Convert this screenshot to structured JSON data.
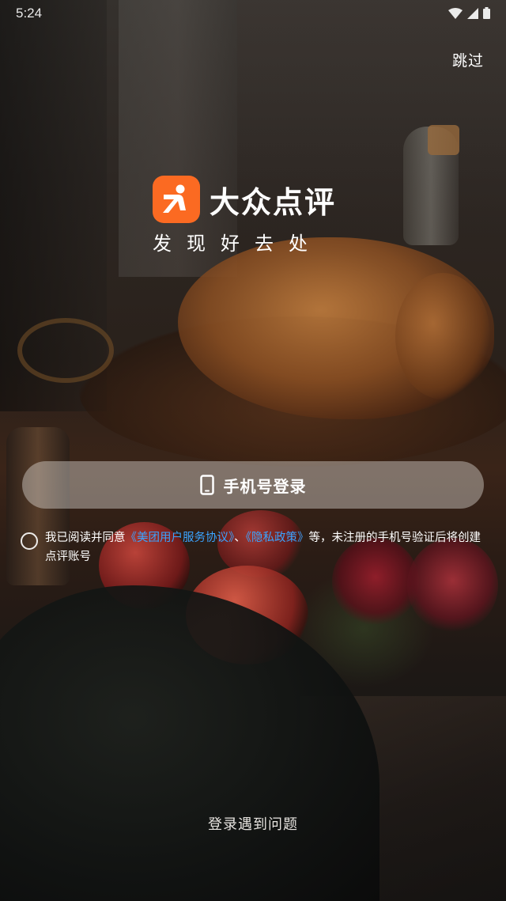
{
  "status_bar": {
    "time": "5:24",
    "icons": [
      "wifi-icon",
      "signal-icon",
      "battery-icon"
    ]
  },
  "header": {
    "skip_label": "跳过"
  },
  "brand": {
    "name": "大众点评",
    "slogan": "发现好去处",
    "logo_icon": "dianping-person-icon",
    "logo_color": "#fb6a22"
  },
  "login": {
    "phone_button_label": "手机号登录",
    "phone_icon": "mobile-phone-icon"
  },
  "agreement": {
    "checked": false,
    "prefix": "我已阅读并同意",
    "service_link": "《美团用户服务协议》",
    "separator": "、",
    "privacy_link": "《隐私政策》",
    "suffix": "等，未注册的手机号验证后将创建点评账号",
    "link_color": "#3aa3ff"
  },
  "footer": {
    "trouble_label": "登录遇到问题"
  }
}
